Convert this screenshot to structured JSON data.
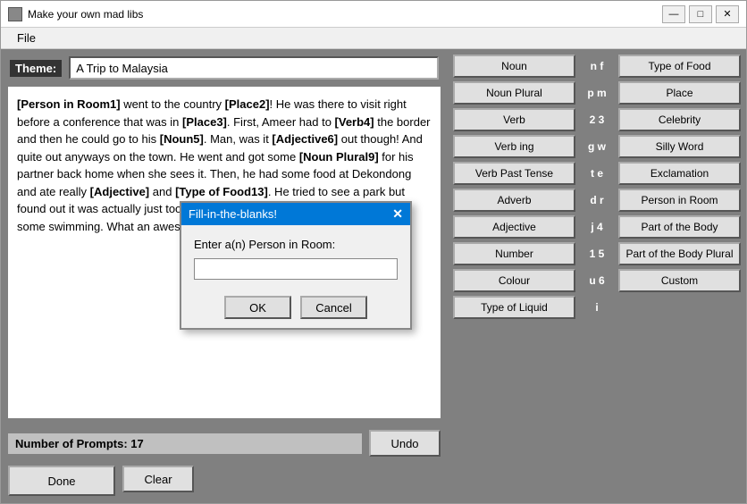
{
  "window": {
    "title": "Make your own mad libs",
    "icon": "window-icon"
  },
  "menu": {
    "file_label": "File"
  },
  "theme": {
    "label": "Theme:",
    "value": "A Trip to Malaysia"
  },
  "story": {
    "text": "[Person in Room1] went to the country [Place2]! He was there to visit right before a conference that was in [Place3]. First, Ameer had to [Verb4] the border and then he could go to his [Noun5]. Man, was it [Adjective6] out though! And quite [Adverb] too. He went out anyways on the town. He went and got some [Noun Plural9] for his partner back home when she sees it. Then, he had some food at Dekondong and ate really [Adjective] and [Type of Food13]. He tried to go to a park but found out it was actually just too much. So instead, he [Verb] [Noun17] for some swimming. What an awesome trip!"
  },
  "bottom": {
    "prompts_label": "Number of Prompts: 17",
    "done_label": "Done",
    "undo_label": "Undo",
    "clear_label": "Clear"
  },
  "word_types": [
    {
      "key": "n",
      "label": "Noun"
    },
    {
      "key": "f",
      "label": "Type of Food"
    },
    {
      "key": "p",
      "label": "Noun Plural"
    },
    {
      "key": "m",
      "label": "Place"
    },
    {
      "key": "2",
      "label": "Verb"
    },
    {
      "key": "3",
      "label": "Celebrity"
    },
    {
      "key": "g",
      "label": "Verb ing"
    },
    {
      "key": "w",
      "label": "Silly Word"
    },
    {
      "key": "t",
      "label": "Verb Past Tense"
    },
    {
      "key": "e",
      "label": "Exclamation"
    },
    {
      "key": "d",
      "label": "Adverb"
    },
    {
      "key": "r",
      "label": "Person in Room"
    },
    {
      "key": "j",
      "label": "Adjective"
    },
    {
      "key": "4",
      "label": "Part of the Body"
    },
    {
      "key": "1",
      "label": "Number"
    },
    {
      "key": "5",
      "label": "Part of the Body Plural"
    },
    {
      "key": "u",
      "label": "Colour"
    },
    {
      "key": "6",
      "label": "Custom"
    },
    {
      "key": "i",
      "label": "Type of Liquid"
    }
  ],
  "dialog": {
    "title": "Fill-in-the-blanks!",
    "prompt": "Enter a(n) Person in Room:",
    "input_value": "",
    "ok_label": "OK",
    "cancel_label": "Cancel"
  }
}
